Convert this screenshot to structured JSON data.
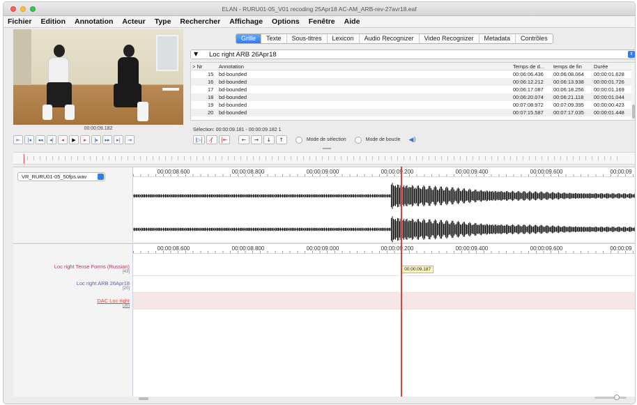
{
  "window": {
    "title": "ELAN - RURU01-05_V01 recoding 25Apr18 AC-AM_ARB-rev-27avr18.eaf"
  },
  "menubar": [
    "Fichier",
    "Edition",
    "Annotation",
    "Acteur",
    "Type",
    "Rechercher",
    "Affichage",
    "Options",
    "Fenêtre",
    "Aide"
  ],
  "video": {
    "timecode": "00:00:09.182"
  },
  "tabs": [
    {
      "label": "Grille",
      "active": true
    },
    {
      "label": "Texte",
      "active": false
    },
    {
      "label": "Sous-titres",
      "active": false
    },
    {
      "label": "Lexicon",
      "active": false
    },
    {
      "label": "Audio Recognizer",
      "active": false
    },
    {
      "label": "Video Recognizer",
      "active": false
    },
    {
      "label": "Metadata",
      "active": false
    },
    {
      "label": "Contrôles",
      "active": false
    }
  ],
  "tier_selector": {
    "arrow": "▼",
    "value": "Loc right ARB 26Apr18"
  },
  "grid": {
    "columns": {
      "marker": "> Nr",
      "annotation": "Annotation",
      "start": "Temps de d...",
      "end": "temps de fin",
      "duration": "Durée"
    },
    "rows": [
      {
        "nr": "15",
        "annotation": "bd-bounded",
        "start": "00:06:06.436",
        "end": "00:06:08.064",
        "duration": "00:00:01.628"
      },
      {
        "nr": "16",
        "annotation": "bd-bounded",
        "start": "00:06:12.212",
        "end": "00:06:13.938",
        "duration": "00:00:01.726"
      },
      {
        "nr": "17",
        "annotation": "bd-bounded",
        "start": "00:06:17.087",
        "end": "00:06:18.256",
        "duration": "00:00:01.169"
      },
      {
        "nr": "18",
        "annotation": "bd-bounded",
        "start": "00:06:20.074",
        "end": "00:06:21.118",
        "duration": "00:00:01.044"
      },
      {
        "nr": "19",
        "annotation": "bd-bounded",
        "start": "00:07:08.972",
        "end": "00:07:09.395",
        "duration": "00:00:00.423"
      },
      {
        "nr": "20",
        "annotation": "bd-bounded",
        "start": "00:07:15.587",
        "end": "00:07:17.035",
        "duration": "00:00:01.448"
      }
    ]
  },
  "selection": {
    "text": "Sélection: 00:00:09.181 - 00:00:09.182  1"
  },
  "controls": {
    "selection_mode": "Mode de sélection",
    "loop_mode": "Mode de boucle"
  },
  "media": {
    "file": "VR_RURU01-05_50fps.wav"
  },
  "ruler_ticks": [
    "00:00:08.600",
    "00:00:08.800",
    "00:00:09.000",
    "00:00:09.200",
    "00:00:09.400",
    "00:00:09.600",
    "00:00:09"
  ],
  "tiers": [
    {
      "name": "Loc right Tense Forms (Russian)",
      "count": "[43]",
      "color": "#b5355e"
    },
    {
      "name": "Loc right ARB 26Apr18",
      "count": "[20]",
      "color": "#5b61a8"
    },
    {
      "name": "DAC Loc right",
      "count": "[30]",
      "color": "#e0413b",
      "active": true
    }
  ],
  "cursor": {
    "time": "00:00:09.187",
    "fraction": 0.528
  },
  "colors": {
    "accent": "#2b7ef1",
    "cursor": "#e0413b",
    "active_tier_bg": "#f7e6e5"
  }
}
